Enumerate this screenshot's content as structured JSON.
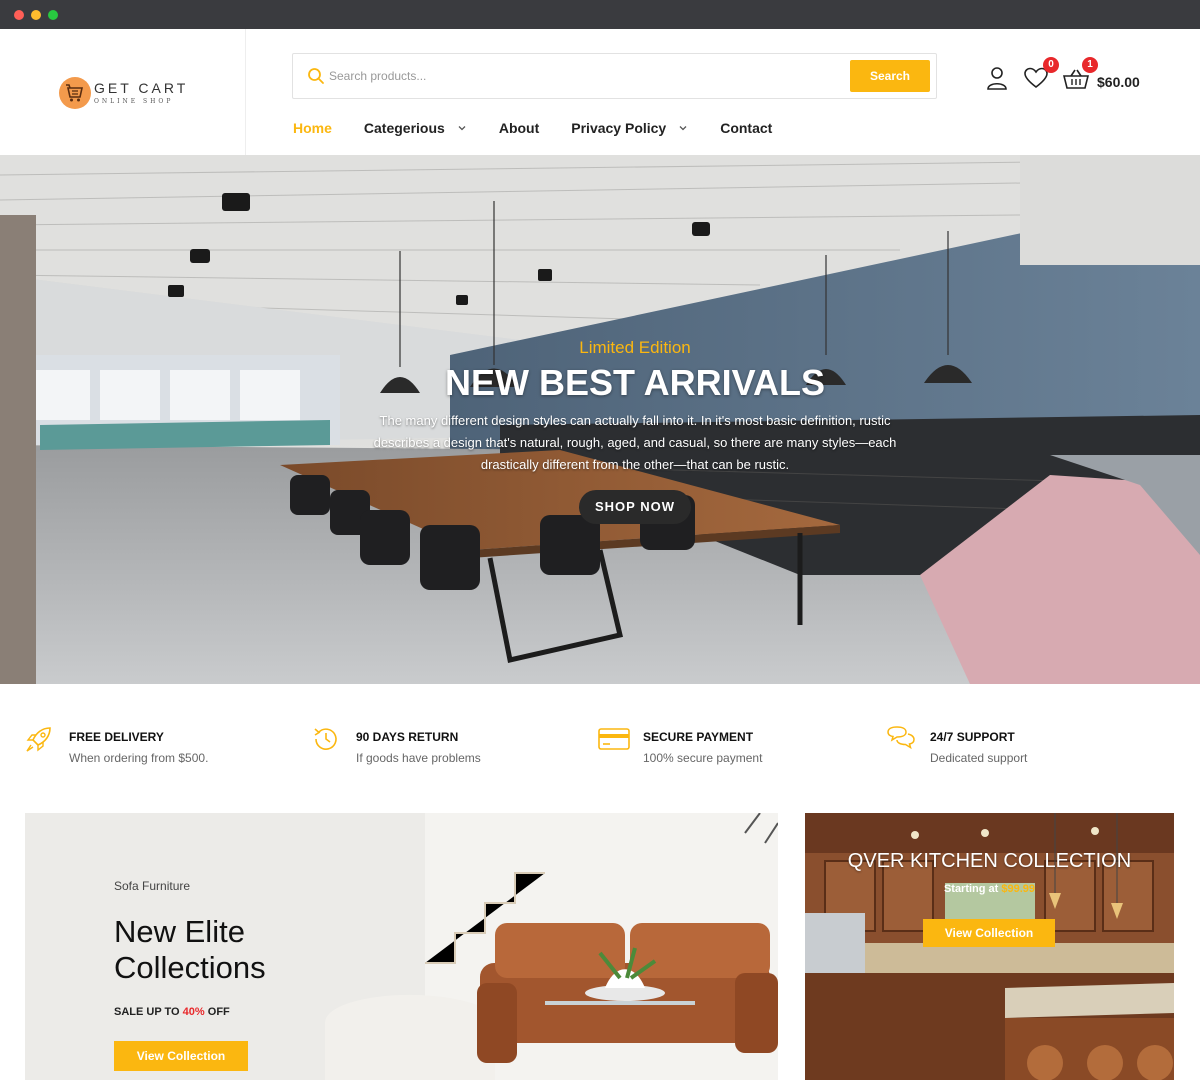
{
  "brand": {
    "name": "GET CART",
    "tagline": "ONLINE SHOP",
    "accent": "#fbb710",
    "badge_color": "#e8282b"
  },
  "search": {
    "placeholder": "Search products...",
    "button": "Search"
  },
  "nav": [
    {
      "label": "Home",
      "active": true,
      "has_dropdown": false
    },
    {
      "label": "Categerious",
      "active": false,
      "has_dropdown": true
    },
    {
      "label": "About",
      "active": false,
      "has_dropdown": false
    },
    {
      "label": "Privacy Policy",
      "active": false,
      "has_dropdown": true
    },
    {
      "label": "Contact",
      "active": false,
      "has_dropdown": false
    }
  ],
  "header_icons": {
    "user_icon": "user-icon",
    "wishlist_icon": "heart-icon",
    "wishlist_count": "0",
    "cart_icon": "basket-icon",
    "cart_count": "1",
    "cart_total": "$60.00"
  },
  "hero": {
    "kicker": "Limited Edition",
    "title": "NEW BEST ARRIVALS",
    "description": "The many different design styles can actually fall into it. In it's most basic definition, rustic describes a design that's natural, rough, aged, and casual, so there are many styles—each drastically different from the other—that can be rustic.",
    "button": "SHOP NOW"
  },
  "features": [
    {
      "icon": "rocket-icon",
      "title": "FREE DELIVERY",
      "subtitle": "When ordering from $500."
    },
    {
      "icon": "history-icon",
      "title": "90 DAYS RETURN",
      "subtitle": "If goods have problems"
    },
    {
      "icon": "credit-card-icon",
      "title": "SECURE PAYMENT",
      "subtitle": "100% secure payment"
    },
    {
      "icon": "chat-icon",
      "title": "24/7 SUPPORT",
      "subtitle": "Dedicated support"
    }
  ],
  "banner_left": {
    "kicker": "Sofa Furniture",
    "title": "New Elite Collections",
    "sale_prefix": "SALE UP TO ",
    "sale_percent": "40%",
    "sale_suffix": " OFF",
    "button": "View Collection"
  },
  "banner_right": {
    "title": "QVER KITCHEN COLLECTION",
    "starting_prefix": "Starting at ",
    "starting_price": "$99.99",
    "button": "View Collection"
  }
}
